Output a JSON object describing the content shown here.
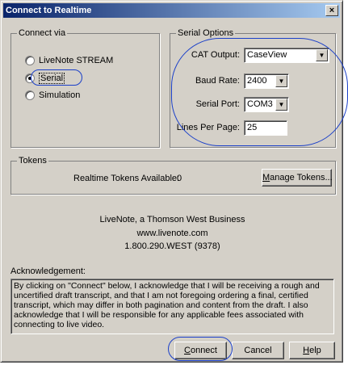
{
  "window": {
    "title": "Connect to Realtime",
    "close_glyph": "×"
  },
  "connect_via": {
    "legend": "Connect via",
    "options": [
      {
        "label": "LiveNote STREAM",
        "selected": false
      },
      {
        "label": "Serial",
        "selected": true
      },
      {
        "label": "Simulation",
        "selected": false
      }
    ]
  },
  "serial_options": {
    "legend": "Serial Options",
    "cat_output": {
      "label": "CAT Output:",
      "value": "CaseView"
    },
    "baud_rate": {
      "label": "Baud Rate:",
      "value": "2400"
    },
    "serial_port": {
      "label": "Serial Port:",
      "value": "COM3"
    },
    "lines_per_page": {
      "label": "Lines Per Page:",
      "value": "25"
    }
  },
  "tokens": {
    "legend": "Tokens",
    "available_label": "Realtime Tokens Available:",
    "available_count": "0",
    "manage_button": "Manage Tokens..."
  },
  "company": {
    "name": "LiveNote, a Thomson West Business",
    "website": "www.livenote.com",
    "phone": "1.800.290.WEST (9378)"
  },
  "acknowledgement": {
    "label": "Acknowledgement:",
    "text": "By clicking on \"Connect\" below, I acknowledge that I will be receiving a rough and uncertified draft transcript, and that I am not foregoing ordering a final, certified transcript, which may differ in both pagination and content from the draft.  I also acknowledge that I will be responsible for any applicable fees associated with connecting to live video."
  },
  "buttons": {
    "connect": "Connect",
    "cancel": "Cancel",
    "help": "Help"
  },
  "colors": {
    "annotation": "#1a3fc9",
    "title_bar": "#0a246a",
    "dialog_face": "#d4d0c8"
  }
}
